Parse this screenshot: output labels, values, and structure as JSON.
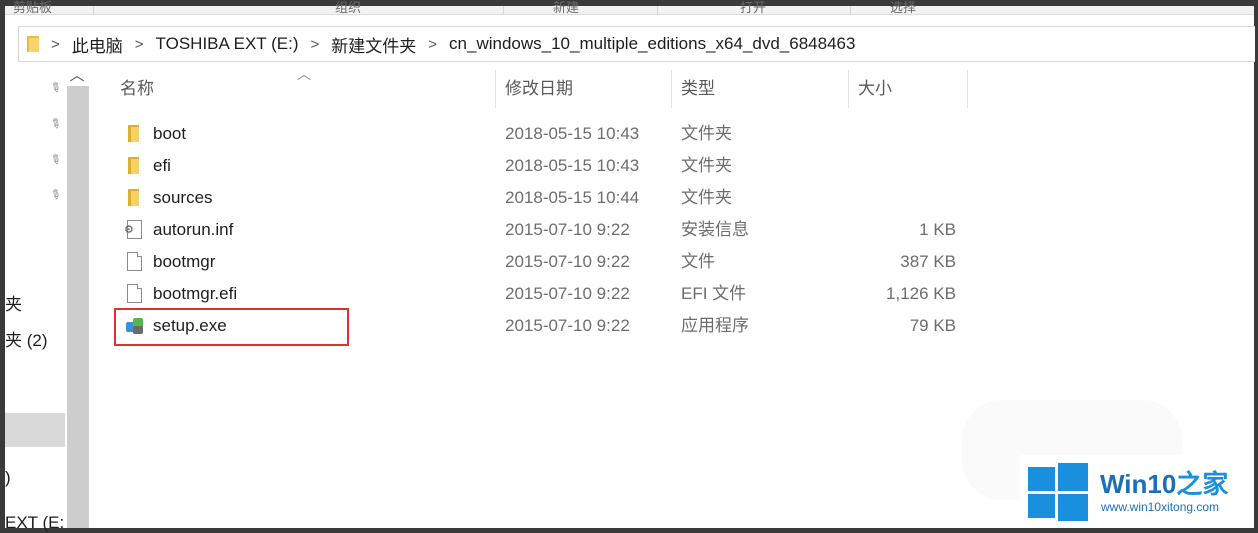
{
  "ribbon": {
    "items": [
      "剪贴板",
      "组织",
      "新建",
      "打开",
      "选择"
    ]
  },
  "address": {
    "crumbs": [
      "此电脑",
      "TOSHIBA EXT (E:)",
      "新建文件夹",
      "cn_windows_10_multiple_editions_x64_dvd_6848463"
    ],
    "separator": ">"
  },
  "nav": {
    "partial_items": [
      "夹",
      "夹 (2)",
      ")",
      "EXT (E:"
    ]
  },
  "columns": {
    "name": "名称",
    "date": "修改日期",
    "type": "类型",
    "size": "大小"
  },
  "files": [
    {
      "name": "boot",
      "date": "2018-05-15 10:43",
      "type": "文件夹",
      "size": "",
      "icon": "folder-icon"
    },
    {
      "name": "efi",
      "date": "2018-05-15 10:43",
      "type": "文件夹",
      "size": "",
      "icon": "folder-icon"
    },
    {
      "name": "sources",
      "date": "2018-05-15 10:44",
      "type": "文件夹",
      "size": "",
      "icon": "folder-icon"
    },
    {
      "name": "autorun.inf",
      "date": "2015-07-10 9:22",
      "type": "安装信息",
      "size": "1 KB",
      "icon": "settings-file-icon"
    },
    {
      "name": "bootmgr",
      "date": "2015-07-10 9:22",
      "type": "文件",
      "size": "387 KB",
      "icon": "file-icon"
    },
    {
      "name": "bootmgr.efi",
      "date": "2015-07-10 9:22",
      "type": "EFI 文件",
      "size": "1,126 KB",
      "icon": "file-icon"
    },
    {
      "name": "setup.exe",
      "date": "2015-07-10 9:22",
      "type": "应用程序",
      "size": "79 KB",
      "icon": "setup-exe-icon"
    }
  ],
  "watermark": {
    "title_a": "Win10",
    "title_b": "之家",
    "url": "www.win10xitong.com"
  },
  "colors": {
    "highlight": "#e03030",
    "folder": "#f5d266",
    "brand": "#1a8fde"
  }
}
